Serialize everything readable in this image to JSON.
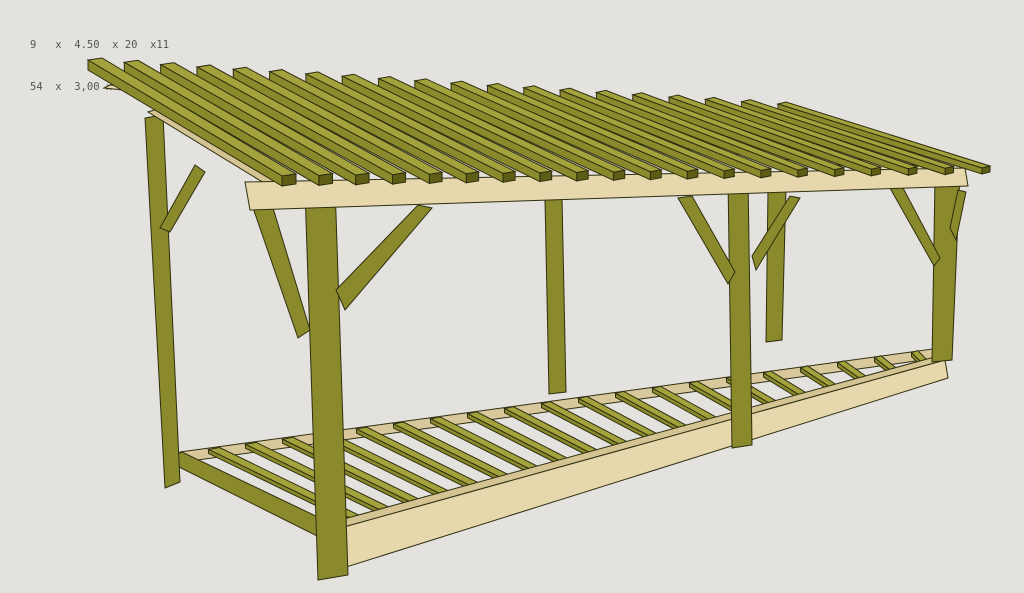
{
  "annotations": {
    "line1": "9   x  4.50  x 20  x11",
    "line2": "54  x  3,00 x  150 x60"
  },
  "colors": {
    "background": "#e4e2df",
    "treated_timber": "#8a8a2c",
    "treated_timber_dark": "#5d5d16",
    "treated_timber_light": "#a3a23d",
    "untreated_timber": "#e6d7ad",
    "untreated_timber_dark": "#c9b68a",
    "outline": "#2e2e10"
  },
  "model": {
    "rafter_count": 20,
    "floor_joist_count": 20,
    "post_count": 6,
    "brace_count": 10
  }
}
